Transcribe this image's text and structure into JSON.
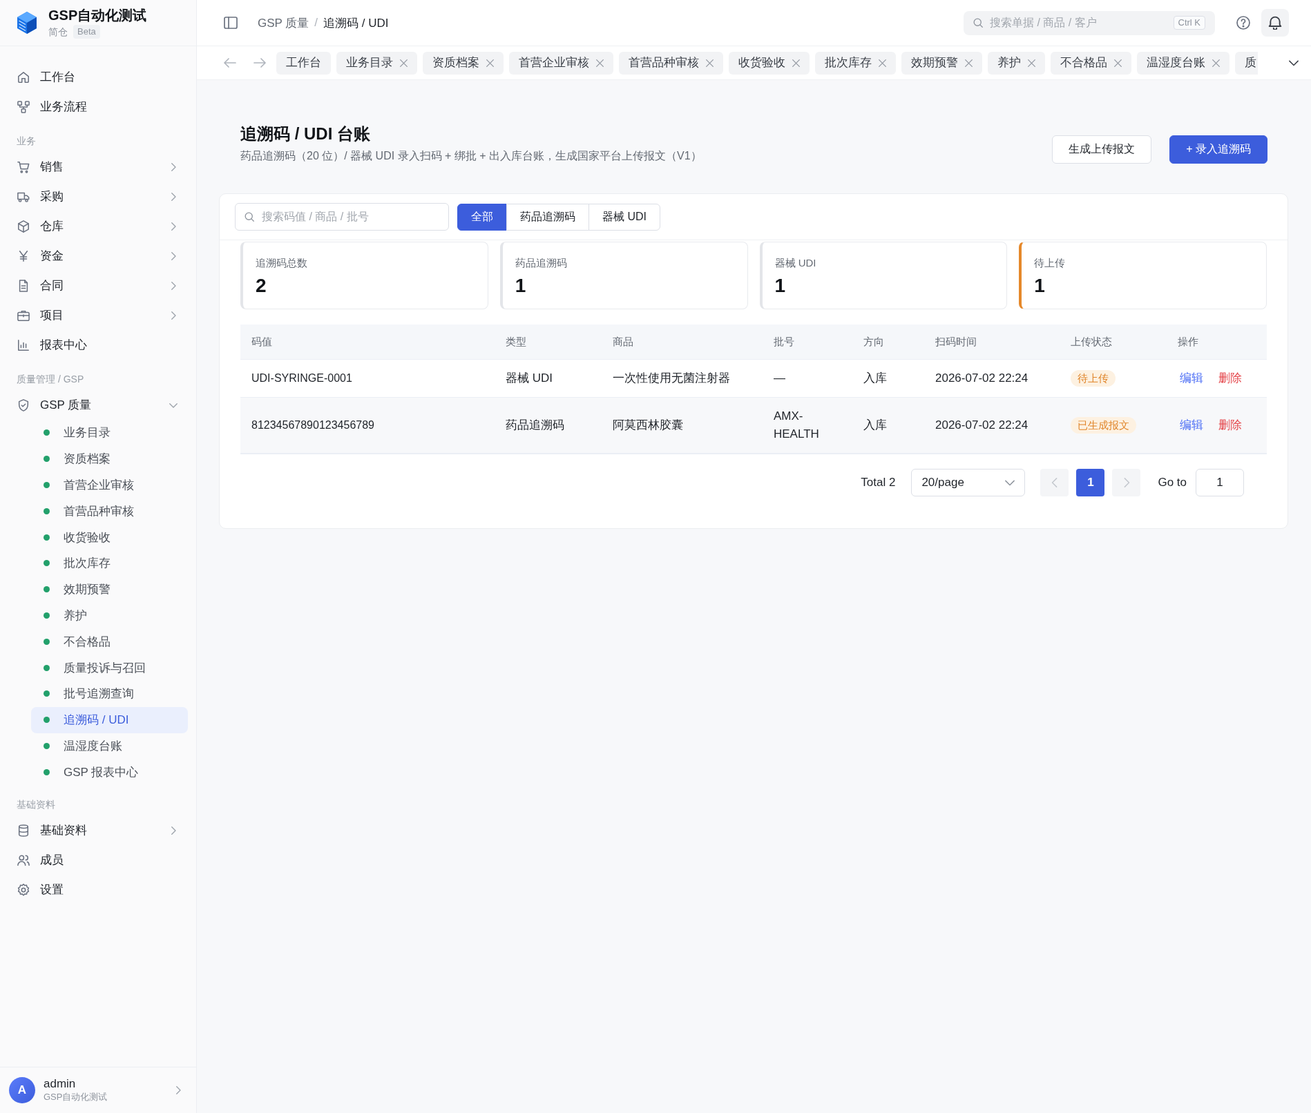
{
  "brand": {
    "title": "GSP自动化测试",
    "subtitle": "简仓",
    "badge": "Beta"
  },
  "sidebar": {
    "sections": [
      {
        "items": [
          {
            "label": "工作台",
            "selected": false
          },
          {
            "label": "业务流程",
            "selected": false
          }
        ]
      },
      {
        "label": "业务",
        "items": [
          {
            "label": "销售",
            "selected": false,
            "expanded": false
          },
          {
            "label": "采购",
            "selected": false,
            "expanded": false
          },
          {
            "label": "仓库",
            "selected": false,
            "expanded": false
          },
          {
            "label": "资金",
            "selected": false,
            "expanded": false
          },
          {
            "label": "合同",
            "selected": false,
            "expanded": false
          },
          {
            "label": "项目",
            "selected": false,
            "expanded": false
          },
          {
            "label": "报表中心",
            "selected": false
          }
        ]
      },
      {
        "label": "质量管理 / GSP",
        "items": [
          {
            "label": "GSP 质量",
            "selected": false,
            "expanded": true,
            "children": [
              {
                "label": "业务目录",
                "selected": false
              },
              {
                "label": "资质档案",
                "selected": false
              },
              {
                "label": "首营企业审核",
                "selected": false
              },
              {
                "label": "首营品种审核",
                "selected": false
              },
              {
                "label": "收货验收",
                "selected": false
              },
              {
                "label": "批次库存",
                "selected": false
              },
              {
                "label": "效期预警",
                "selected": false
              },
              {
                "label": "养护",
                "selected": false
              },
              {
                "label": "不合格品",
                "selected": false
              },
              {
                "label": "质量投诉与召回",
                "selected": false
              },
              {
                "label": "批号追溯查询",
                "selected": false
              },
              {
                "label": "追溯码 / UDI",
                "selected": true
              },
              {
                "label": "温湿度台账",
                "selected": false
              },
              {
                "label": "GSP 报表中心",
                "selected": false
              }
            ]
          }
        ]
      },
      {
        "label": "基础资料",
        "items": [
          {
            "label": "基础资料",
            "selected": false,
            "expanded": false
          },
          {
            "label": "成员",
            "selected": false
          },
          {
            "label": "设置",
            "selected": false
          }
        ]
      }
    ],
    "user": {
      "initial": "A",
      "name": "admin",
      "org": "GSP自动化测试"
    }
  },
  "topbar": {
    "breadcrumb": {
      "items": [
        "GSP 质量",
        "追溯码 / UDI"
      ],
      "separator": "/"
    },
    "search": {
      "placeholder": "搜索单据 / 商品 / 客户",
      "shortcut": "Ctrl K"
    }
  },
  "tabs": [
    {
      "label": "工作台",
      "closable": false,
      "selected": false
    },
    {
      "label": "业务目录",
      "closable": true,
      "selected": false
    },
    {
      "label": "资质档案",
      "closable": true,
      "selected": false
    },
    {
      "label": "首营企业审核",
      "closable": true,
      "selected": false
    },
    {
      "label": "首营品种审核",
      "closable": true,
      "selected": false
    },
    {
      "label": "收货验收",
      "closable": true,
      "selected": false
    },
    {
      "label": "批次库存",
      "closable": true,
      "selected": false
    },
    {
      "label": "效期预警",
      "closable": true,
      "selected": false
    },
    {
      "label": "养护",
      "closable": true,
      "selected": false
    },
    {
      "label": "不合格品",
      "closable": true,
      "selected": false
    },
    {
      "label": "温湿度台账",
      "closable": true,
      "selected": false
    },
    {
      "label": "质",
      "closable": false,
      "selected": false
    }
  ],
  "page": {
    "title": "追溯码 / UDI 台账",
    "subtitle": "药品追溯码（20 位）/ 器械 UDI 录入扫码 + 绑批 + 出入库台账，生成国家平台上传报文（V1）",
    "buttons": [
      {
        "label": "生成上传报文",
        "kind": "default"
      },
      {
        "label": "+ 录入追溯码",
        "kind": "primary"
      }
    ]
  },
  "filter": {
    "search": {
      "placeholder": "搜索码值 / 商品 / 批号"
    },
    "segments": [
      {
        "label": "全部",
        "selected": true
      },
      {
        "label": "药品追溯码",
        "selected": false
      },
      {
        "label": "器械 UDI",
        "selected": false
      }
    ]
  },
  "stats": [
    {
      "label": "追溯码总数",
      "value": "2",
      "color": "#e3e5e9"
    },
    {
      "label": "药品追溯码",
      "value": "1",
      "color": "#e3e5e9"
    },
    {
      "label": "器械 UDI",
      "value": "1",
      "color": "#e3e5e9"
    },
    {
      "label": "待上传",
      "value": "1",
      "color": "#e5882a"
    }
  ],
  "table": {
    "columns": [
      "码值",
      "类型",
      "商品",
      "批号",
      "方向",
      "扫码时间",
      "上传状态",
      "操作"
    ],
    "rows": [
      {
        "code": "UDI-SYRINGE-0001",
        "type": "器械 UDI",
        "product": "一次性使用无菌注射器",
        "batch": "—",
        "direction": "入库",
        "scanned_at": "2026-07-02 22:24",
        "status": "待上传",
        "actions": [
          {
            "label": "编辑",
            "kind": "edit"
          },
          {
            "label": "删除",
            "kind": "delete"
          }
        ]
      },
      {
        "code": "81234567890123456789",
        "type": "药品追溯码",
        "product": "阿莫西林胶囊",
        "batch": "AMX-HEALTH",
        "direction": "入库",
        "scanned_at": "2026-07-02 22:24",
        "status": "已生成报文",
        "actions": [
          {
            "label": "编辑",
            "kind": "edit"
          },
          {
            "label": "删除",
            "kind": "delete"
          }
        ]
      }
    ]
  },
  "pagination": {
    "total": "Total 2",
    "page_size": "20/page",
    "prev": {
      "disabled": true
    },
    "pages": [
      {
        "label": "1",
        "selected": true
      }
    ],
    "next": {
      "disabled": true
    },
    "goto_label": "Go to",
    "goto_value": "1"
  }
}
